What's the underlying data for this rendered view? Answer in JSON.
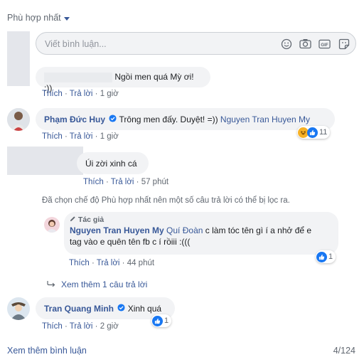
{
  "sort": {
    "label": "Phù hợp nhất"
  },
  "composer": {
    "placeholder": "Viết bình luận...",
    "icons": [
      "emoji-icon",
      "camera-icon",
      "gif-icon",
      "sticker-icon"
    ]
  },
  "comments": [
    {
      "name": "",
      "text": "Ngồi men quá Mỳ ơi! :))",
      "like": "Thích",
      "reply": "Trả lời",
      "time": "1 giờ"
    },
    {
      "name": "Phạm Đức Huy",
      "text": "Trông men đấy. Duyệt! =))",
      "tag": "Nguyen Tran Huyen My",
      "like": "Thích",
      "reply": "Trả lời",
      "time": "1 giờ",
      "reactions": "11"
    },
    {
      "name": "",
      "text": "Úi zời xinh cá",
      "like": "Thích",
      "reply": "Trả lời",
      "time": "57 phút"
    }
  ],
  "notice": "Đã chọn chế độ Phù hợp nhất nên một số câu trả lời có thể bị lọc ra.",
  "reply": {
    "badge": "Tác giả",
    "name": "Nguyen Tran Huyen My",
    "tag": "Quí Đoàn",
    "text_line1": "c làm tóc tên gì í a nhở để e",
    "text_line2": "tag vào e quên tên fb c í rồiii :(((",
    "like": "Thích",
    "reply": "Trả lời",
    "time": "44 phút",
    "reactions": "1"
  },
  "more_replies": "Xem thêm 1 câu trả lời",
  "comment4": {
    "name": "Tran Quang Minh",
    "text": "Xinh quá",
    "like": "Thích",
    "reply": "Trả lời",
    "time": "2 giờ",
    "reactions": "1"
  },
  "footer": {
    "more_comments": "Xem thêm bình luận",
    "count": "4/124"
  },
  "colors": {
    "link": "#385898",
    "bubble": "#f2f3f5",
    "meta": "#606770",
    "like": "#1877f2"
  }
}
